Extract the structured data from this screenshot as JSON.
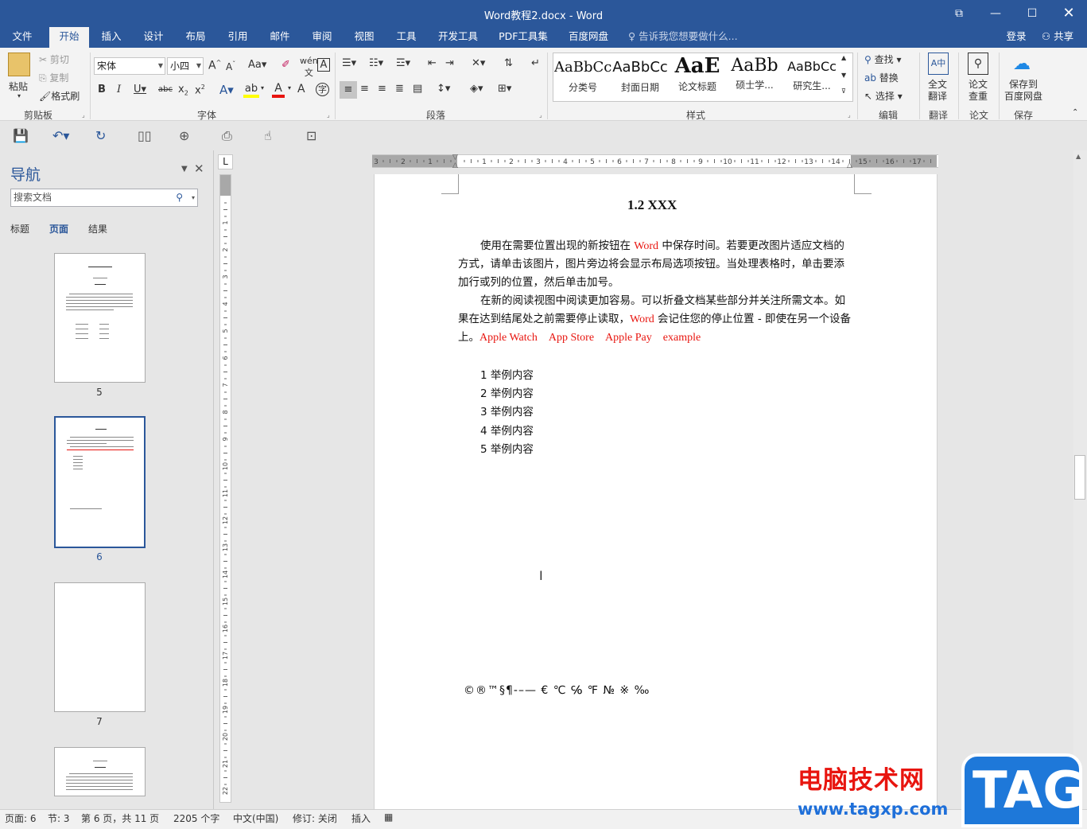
{
  "window": {
    "title": "Word教程2.docx - Word"
  },
  "tabs": [
    "文件",
    "开始",
    "插入",
    "设计",
    "布局",
    "引用",
    "邮件",
    "审阅",
    "视图",
    "工具",
    "开发工具",
    "PDF工具集",
    "百度网盘"
  ],
  "tell_me": "告诉我您想要做什么...",
  "account": {
    "login": "登录",
    "share": "共享"
  },
  "clipboard": {
    "paste": "粘贴",
    "cut": "剪切",
    "copy": "复制",
    "format_painter": "格式刷",
    "label": "剪贴板"
  },
  "font": {
    "name": "宋体",
    "size": "小四",
    "label": "字体"
  },
  "paragraph": {
    "label": "段落"
  },
  "styles": {
    "label": "样式",
    "items": [
      {
        "sample": "AaBbCc",
        "name": "分类号"
      },
      {
        "sample": "AaBbCc",
        "name": "封面日期"
      },
      {
        "sample": "AaE",
        "name": "论文标题"
      },
      {
        "sample": "AaBb",
        "name": "硕士学..."
      },
      {
        "sample": "AaBbCc",
        "name": "研究生..."
      }
    ]
  },
  "editing": {
    "find": "查找",
    "replace": "替换",
    "select": "选择",
    "label": "编辑"
  },
  "translate": {
    "btn_line1": "全文",
    "btn_line2": "翻译",
    "label": "翻译"
  },
  "paper": {
    "btn_line1": "论文",
    "btn_line2": "查重",
    "label": "论文"
  },
  "save_group": {
    "btn_line1": "保存到",
    "btn_line2": "百度网盘",
    "label": "保存"
  },
  "nav": {
    "title": "导航",
    "search_placeholder": "搜索文档",
    "tabs": [
      "标题",
      "页面",
      "结果"
    ],
    "pages": [
      "5",
      "6",
      "7"
    ]
  },
  "document": {
    "heading": "1.2 XXX",
    "para1_a": "使用在需要位置出现的新按钮在 ",
    "para1_word": "Word",
    "para1_b": " 中保存时间。若要更改图片适应文档的方式，请单击该图片，图片旁边将会显示布局选项按钮。当处理表格时，单击要添加行或列的位置，然后单击加号。",
    "para2_a": "在新的阅读视图中阅读更加容易。可以折叠文档某些部分并关注所需文本。如果在达到结尾处之前需要停止读取，",
    "para2_word": "Word",
    "para2_b": " 会记住您的停止位置 - 即使在另一个设备上。",
    "red_terms": [
      "Apple Watch",
      "App Store",
      "Apple Pay",
      "example"
    ],
    "list": [
      "1 举例内容",
      "2 举例内容",
      "3 举例内容",
      "4 举例内容",
      "5 举例内容"
    ],
    "symbols": "©®™§¶‐–— € ℃ ℅ ℉ № ※ ‰"
  },
  "status": {
    "page": "页面: 6",
    "section": "节: 3",
    "page_of": "第 6 页，共 11 页",
    "words": "2205 个字",
    "language": "中文(中国)",
    "track": "修订: 关闭",
    "insert": "插入"
  },
  "watermark": {
    "text": "电脑技术网",
    "url": "www.tagxp.com",
    "badge": "TAG"
  },
  "colors": {
    "brand": "#2b579a",
    "red_text": "#e8150f",
    "watermark_blue": "#1e78d9"
  }
}
